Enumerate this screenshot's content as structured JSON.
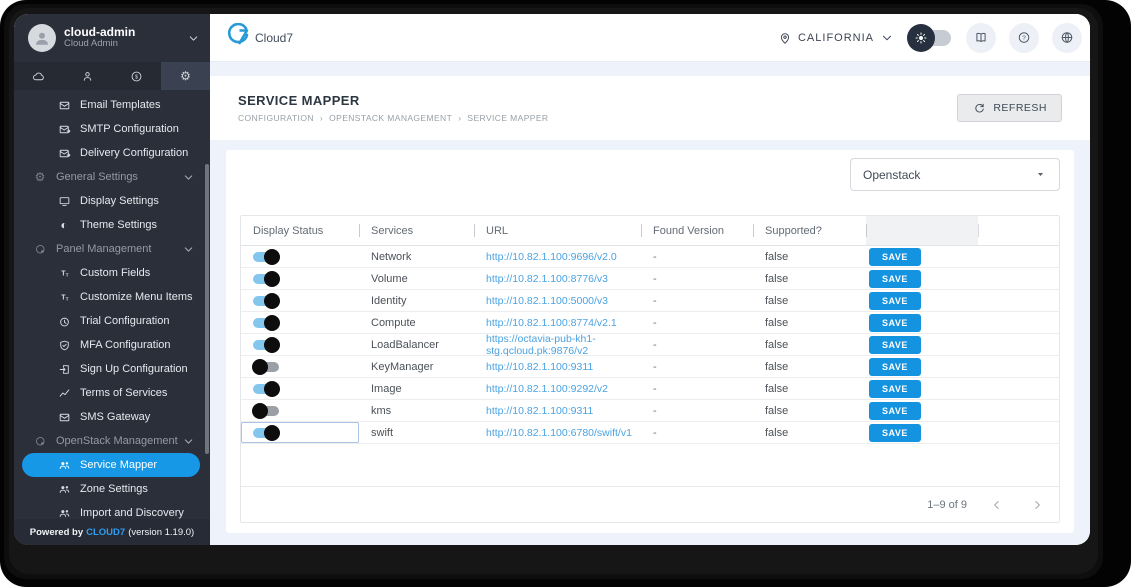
{
  "colors": {
    "accent_blue": "#1798e6",
    "link_blue": "#4aa3e2",
    "save_button_blue": "#1493e0",
    "sidebar_bg": "#2b2f3a",
    "toggle_on_track": "#85c6ee",
    "content_bg": "#eef2fa"
  },
  "sidebar": {
    "user": {
      "name": "cloud-admin",
      "role": "Cloud Admin"
    },
    "tabs": [
      {
        "name": "cloud",
        "icon": "cloud"
      },
      {
        "name": "users",
        "icon": "user"
      },
      {
        "name": "billing",
        "icon": "dollar"
      },
      {
        "name": "settings",
        "icon": "gear",
        "active": true
      }
    ],
    "menu": [
      {
        "type": "item",
        "icon": "envelope",
        "label": "Email Templates"
      },
      {
        "type": "item",
        "icon": "envelope-out",
        "label": "SMTP Configuration"
      },
      {
        "type": "item",
        "icon": "envelope-out",
        "label": "Delivery Configuration"
      },
      {
        "type": "section",
        "icon": "gear",
        "label": "General Settings"
      },
      {
        "type": "item",
        "icon": "monitor",
        "label": "Display Settings"
      },
      {
        "type": "item",
        "icon": "theme",
        "label": "Theme Settings"
      },
      {
        "type": "section",
        "icon": "panel",
        "label": "Panel Management"
      },
      {
        "type": "item",
        "icon": "text",
        "label": "Custom Fields"
      },
      {
        "type": "item",
        "icon": "text",
        "label": "Customize Menu Items"
      },
      {
        "type": "item",
        "icon": "trial",
        "label": "Trial Configuration"
      },
      {
        "type": "item",
        "icon": "shield",
        "label": "MFA Configuration"
      },
      {
        "type": "item",
        "icon": "signup",
        "label": "Sign Up Configuration"
      },
      {
        "type": "item",
        "icon": "chart",
        "label": "Terms of Services"
      },
      {
        "type": "item",
        "icon": "envelope",
        "label": "SMS Gateway"
      },
      {
        "type": "section",
        "icon": "panel",
        "label": "OpenStack Management"
      },
      {
        "type": "item",
        "icon": "people",
        "label": "Service Mapper",
        "active": true
      },
      {
        "type": "item",
        "icon": "people",
        "label": "Zone Settings"
      },
      {
        "type": "item",
        "icon": "people",
        "label": "Import and Discovery"
      }
    ],
    "footer": {
      "prefix": "Powered by",
      "brand": "CLOUD7",
      "suffix": "(version 1.19.0)"
    }
  },
  "topbar": {
    "brand": "Cloud7",
    "region": "CALIFORNIA"
  },
  "page": {
    "title": "SERVICE MAPPER",
    "breadcrumb": [
      "CONFIGURATION",
      "OPENSTACK MANAGEMENT",
      "SERVICE MAPPER"
    ],
    "breadcrumb_separator": "›",
    "refresh_label": "REFRESH"
  },
  "filter": {
    "value": "Openstack"
  },
  "table": {
    "columns": [
      "Display Status",
      "Services",
      "URL",
      "Found Version",
      "Supported?"
    ],
    "rows": [
      {
        "enabled": true,
        "service": "Network",
        "url": "http://10.82.1.100:9696/v2.0",
        "found_version": "-",
        "supported": "false",
        "action": "SAVE"
      },
      {
        "enabled": true,
        "service": "Volume",
        "url": "http://10.82.1.100:8776/v3",
        "found_version": "-",
        "supported": "false",
        "action": "SAVE"
      },
      {
        "enabled": true,
        "service": "Identity",
        "url": "http://10.82.1.100:5000/v3",
        "found_version": "-",
        "supported": "false",
        "action": "SAVE"
      },
      {
        "enabled": true,
        "service": "Compute",
        "url": "http://10.82.1.100:8774/v2.1",
        "found_version": "-",
        "supported": "false",
        "action": "SAVE"
      },
      {
        "enabled": true,
        "service": "LoadBalancer",
        "url": "https://octavia-pub-kh1-stg.qcloud.pk:9876/v2",
        "found_version": "-",
        "supported": "false",
        "action": "SAVE"
      },
      {
        "enabled": false,
        "service": "KeyManager",
        "url": "http://10.82.1.100:9311",
        "found_version": "-",
        "supported": "false",
        "action": "SAVE"
      },
      {
        "enabled": true,
        "service": "Image",
        "url": "http://10.82.1.100:9292/v2",
        "found_version": "-",
        "supported": "false",
        "action": "SAVE"
      },
      {
        "enabled": false,
        "service": "kms",
        "url": "http://10.82.1.100:9311",
        "found_version": "-",
        "supported": "false",
        "action": "SAVE"
      },
      {
        "enabled": true,
        "service": "swift",
        "url": "http://10.82.1.100:6780/swift/v1",
        "found_version": "-",
        "supported": "false",
        "action": "SAVE",
        "focused": true
      }
    ],
    "pagination": {
      "range_label": "1–9 of 9"
    }
  }
}
